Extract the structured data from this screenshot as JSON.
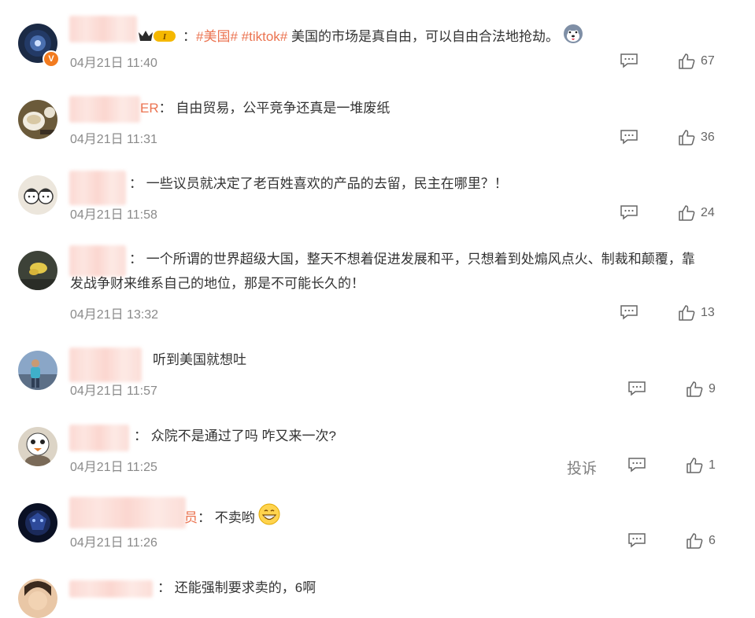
{
  "comments": [
    {
      "name_tail": "",
      "colon": "：",
      "topic1": "#美国#",
      "topic2": "#tiktok#",
      "text": "美国的市场是真自由，可以自由合法地抢劫。",
      "time": "04月21日 11:40",
      "likes": "67",
      "verified_badge": "V",
      "badge_icon": "crown-level-badge-icon",
      "trailing_emoji": "husky-emoji-icon"
    },
    {
      "name_tail": "ER",
      "colon": "：",
      "text": "自由贸易，公平竞争还真是一堆废纸",
      "time": "04月21日 11:31",
      "likes": "36"
    },
    {
      "name_tail": "",
      "colon": "：",
      "text": "一些议员就决定了老百姓喜欢的产品的去留，民主在哪里？！",
      "time": "04月21日 11:58",
      "likes": "24"
    },
    {
      "name_tail": "",
      "colon": "：",
      "text_line1": "一个所谓的世界超级大国，整天不想着促进发展和平，只想着到处煽风点火、制裁和颠覆，靠",
      "text_line2": "发战争财来维系自己的地位，那是不可能长久的！",
      "time": "04月21日 13:32",
      "likes": "13"
    },
    {
      "name_tail": "",
      "colon": "",
      "text": "听到美国就想吐",
      "time": "04月21日 11:57",
      "likes": "9"
    },
    {
      "name_tail": "",
      "colon": "：",
      "text": "众院不是通过了吗 咋又来一次?",
      "time": "04月21日 11:25",
      "likes": "1",
      "report": "投诉"
    },
    {
      "name_tail": "员",
      "colon": "：",
      "text": "不卖哟",
      "time": "04月21日 11:26",
      "likes": "6",
      "trailing_emoji": "grin-emoji-icon"
    },
    {
      "name_tail": "",
      "colon": "：",
      "text": "还能强制要求卖的，6啊"
    }
  ],
  "colors": {
    "topic": "#eb7350",
    "time": "#8a8a8a",
    "text": "#333333",
    "icon": "#666666",
    "verified": "#f27b1f"
  }
}
